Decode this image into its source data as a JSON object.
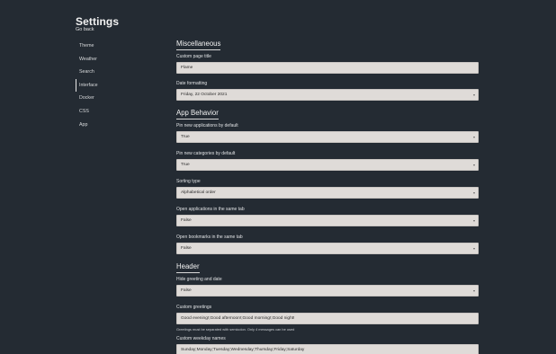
{
  "header": {
    "title": "Settings",
    "back_link": "Go back"
  },
  "sidebar": {
    "items": [
      {
        "label": "Theme"
      },
      {
        "label": "Weather"
      },
      {
        "label": "Search"
      },
      {
        "label": "Interface",
        "active": true
      },
      {
        "label": "Docker"
      },
      {
        "label": "CSS"
      },
      {
        "label": "App"
      }
    ]
  },
  "misc": {
    "title": "Miscellaneous",
    "page_title_label": "Custom page title",
    "page_title_value": "Flame",
    "date_format_label": "Date formatting",
    "date_format_value": "Friday, 22 October 2021"
  },
  "behavior": {
    "title": "App Behavior",
    "pin_apps_label": "Pin new applications by default",
    "pin_apps_value": "True",
    "pin_categories_label": "Pin new categories by default",
    "pin_categories_value": "True",
    "sorting_label": "Sorting type",
    "sorting_value": "Alphabetical order",
    "open_apps_label": "Open applications in the same tab",
    "open_apps_value": "False",
    "open_bookmarks_label": "Open bookmarks in the same tab",
    "open_bookmarks_value": "False"
  },
  "header_section": {
    "title": "Header",
    "hide_greeting_label": "Hide greeting and date",
    "hide_greeting_value": "False",
    "greetings_label": "Custom greetings",
    "greetings_value": "Good evening!;Good afternoon!;Good morning!;Good night!",
    "greetings_hint": "Greetings must be separated with semicolon. Only 4 messages can be used",
    "weekday_label": "Custom weekday names",
    "weekday_value": "Sunday;Monday;Tuesday;Wednesday;Thursday;Friday;Saturday"
  },
  "icons": {
    "select_arrow": "chevron-down-icon"
  },
  "colors": {
    "background": "#242b33",
    "field": "#dfdbd8",
    "text": "#e8e8e8"
  }
}
